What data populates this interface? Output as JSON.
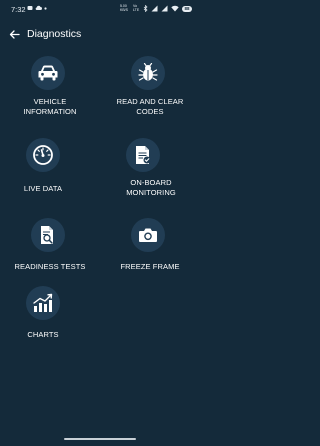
{
  "status_bar": {
    "time": "7:32",
    "left_icons": [
      "notification-icon",
      "cloud-icon",
      "dot-icon"
    ],
    "right_icons": [
      "data-speed-icon",
      "volte-icon",
      "bluetooth-icon",
      "signal-icon",
      "signal-icon",
      "wifi-icon"
    ],
    "data_speed": "5.00 KB/S",
    "volte": "Vo LTE",
    "battery": "88"
  },
  "app_bar": {
    "title": "Diagnostics",
    "back_icon": "back-arrow-icon"
  },
  "tiles": [
    {
      "id": "vehicle-information",
      "label_line1": "VEHICLE",
      "label_line2": "INFORMATION",
      "icon": "car-icon"
    },
    {
      "id": "read-and-clear-codes",
      "label_line1": "READ AND CLEAR",
      "label_line2": "CODES",
      "icon": "bug-icon"
    },
    {
      "id": "live-data",
      "label_line1": "LIVE DATA",
      "label_line2": "",
      "icon": "gauge-icon"
    },
    {
      "id": "on-board-monitoring",
      "label_line1": "ON-BOARD",
      "label_line2": "MONITORING",
      "icon": "document-check-icon"
    },
    {
      "id": "readiness-tests",
      "label_line1": "READINESS TESTS",
      "label_line2": "",
      "icon": "document-search-icon"
    },
    {
      "id": "freeze-frame",
      "label_line1": "FREEZE FRAME",
      "label_line2": "",
      "icon": "camera-icon"
    },
    {
      "id": "charts",
      "label_line1": "CHARTS",
      "label_line2": "",
      "icon": "bar-chart-icon"
    }
  ],
  "colors": {
    "background": "#142a3a",
    "icon_circle": "#213d54",
    "text": "#ffffff"
  }
}
